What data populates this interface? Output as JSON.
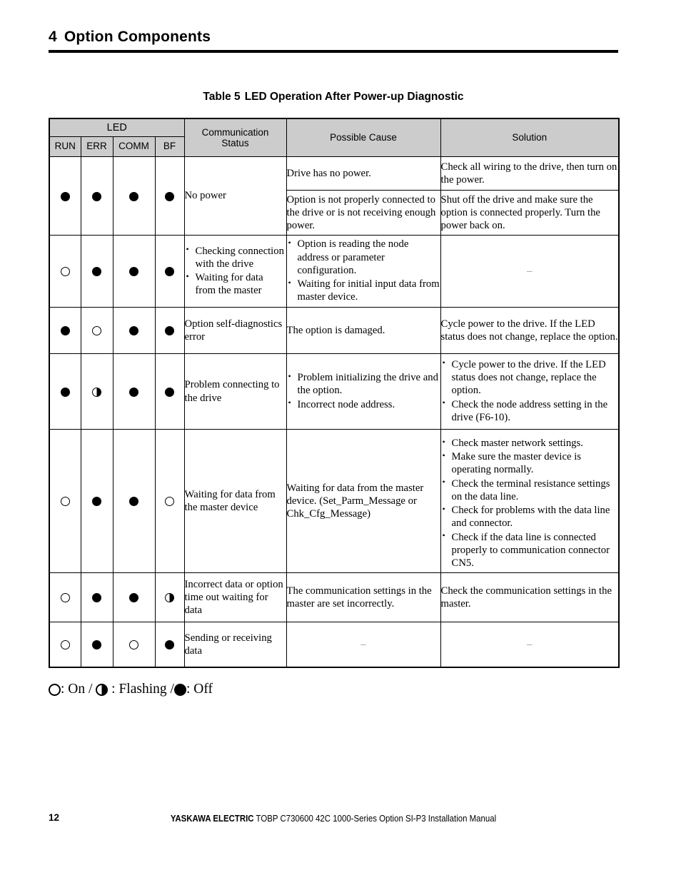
{
  "header": {
    "chapter_number": "4",
    "chapter_title": "Option Components"
  },
  "caption": {
    "label": "Table 5",
    "title": "LED Operation After Power-up Diagnostic"
  },
  "table": {
    "headers": {
      "led_group": "LED",
      "run": "RUN",
      "err": "ERR",
      "comm": "COMM",
      "bf": "BF",
      "communication_status": "Communication\nStatus",
      "communication_status_line1": "Communication",
      "communication_status_line2": "Status",
      "possible_cause": "Possible Cause",
      "solution": "Solution"
    },
    "rows": [
      {
        "leds": {
          "run": "off",
          "err": "off",
          "comm": "off",
          "bf": "off"
        },
        "communication_status": "No power",
        "subrows": [
          {
            "possible_cause": "Drive has no power.",
            "solution": "Check all wiring to the drive, then turn on the power."
          },
          {
            "possible_cause": "Option is not properly connected to the drive or is not receiving enough power.",
            "solution": "Shut off the drive and make sure the option is connected properly. Turn the power back on."
          }
        ]
      },
      {
        "leds": {
          "run": "on",
          "err": "off",
          "comm": "off",
          "bf": "off"
        },
        "communication_status_bullets": [
          "Checking connection with the drive",
          "Waiting for data from the master"
        ],
        "possible_cause_bullets": [
          "Option is reading the node address or parameter configuration.",
          "Waiting for initial input data from master device."
        ],
        "solution": "–"
      },
      {
        "leds": {
          "run": "off",
          "err": "on",
          "comm": "off",
          "bf": "off"
        },
        "communication_status": "Option self-diagnostics error",
        "possible_cause": "The option is damaged.",
        "solution": "Cycle power to the drive. If the LED status does not change, replace the option."
      },
      {
        "leds": {
          "run": "off",
          "err": "flash",
          "comm": "off",
          "bf": "off"
        },
        "communication_status": "Problem connecting to the drive",
        "possible_cause_bullets": [
          "Problem initializing the drive and the option.",
          "Incorrect node address."
        ],
        "solution_bullets": [
          "Cycle power to the drive. If the LED status does not change, replace the option.",
          "Check the node address setting in the drive (F6-10)."
        ]
      },
      {
        "leds": {
          "run": "on",
          "err": "off",
          "comm": "off",
          "bf": "on"
        },
        "communication_status": "Waiting for data from the master device",
        "possible_cause": "Waiting for data from the master device. (Set_Parm_Message or Chk_Cfg_Message)",
        "solution_bullets": [
          "Check master network settings.",
          "Make sure the master device is operating normally.",
          "Check the terminal resistance settings on the data line.",
          "Check for problems with the data line and connector.",
          "Check if the data line is connected properly to communication connector CN5."
        ]
      },
      {
        "leds": {
          "run": "on",
          "err": "off",
          "comm": "off",
          "bf": "flash"
        },
        "communication_status": "Incorrect data or option time out waiting for data",
        "possible_cause": "The communication settings in the master are set incorrectly.",
        "solution": "Check the communication settings in the master."
      },
      {
        "leds": {
          "run": "on",
          "err": "off",
          "comm": "on",
          "bf": "off"
        },
        "communication_status": "Sending or receiving data",
        "possible_cause": "–",
        "solution": "–"
      }
    ]
  },
  "legend": {
    "on_label": ": On /",
    "flashing_label": ": Flashing /",
    "off_label": ": Off"
  },
  "footer": {
    "page_number": "12",
    "brand": "YASKAWA ELECTRIC",
    "doc_text": " TOBP C730600 42C 1000-Series Option SI-P3 Installation Manual"
  }
}
